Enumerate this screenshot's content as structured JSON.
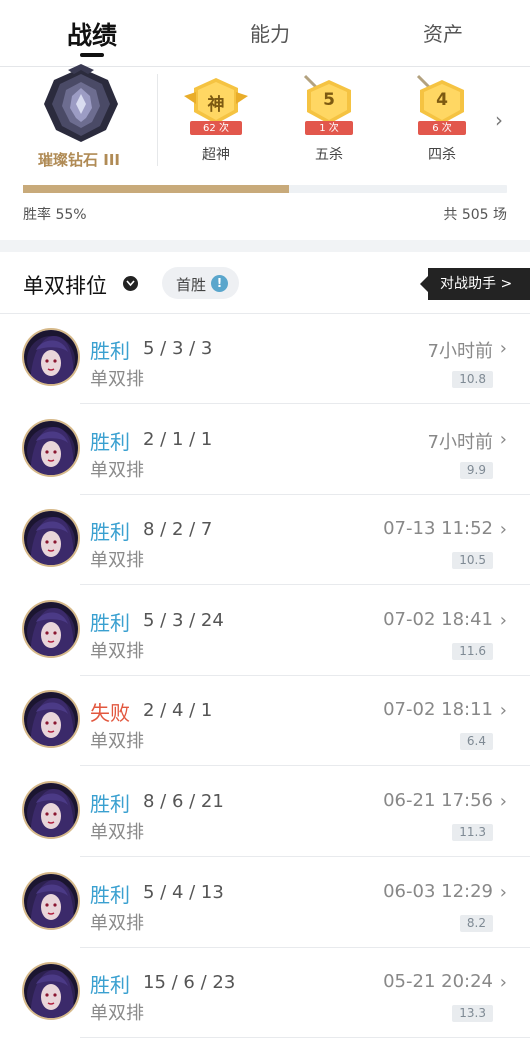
{
  "tabs": [
    "战绩",
    "能力",
    "资产"
  ],
  "rank": {
    "name": "璀璨钻石 III"
  },
  "medals": [
    {
      "glyph": "神",
      "count": "62 次",
      "label": "超神",
      "icon": "shield-medal-icon"
    },
    {
      "glyph": "5",
      "count": "1 次",
      "label": "五杀",
      "icon": "sword-medal-icon"
    },
    {
      "glyph": "4",
      "count": "6 次",
      "label": "四杀",
      "icon": "sword-medal-icon"
    }
  ],
  "stats": {
    "win_rate_text": "胜率 55%",
    "win_rate": 0.55,
    "total_text": "共 505 场"
  },
  "filter": {
    "mode": "单双排位",
    "first_win": "首胜",
    "first_win_badge": "!",
    "assistant": "对战助手 >"
  },
  "matches": [
    {
      "result": "胜利",
      "outcome": "win",
      "kda": "5 / 3 / 3",
      "queue": "单双排",
      "time": "7小时前",
      "score": "10.8"
    },
    {
      "result": "胜利",
      "outcome": "win",
      "kda": "2 / 1 / 1",
      "queue": "单双排",
      "time": "7小时前",
      "score": "9.9"
    },
    {
      "result": "胜利",
      "outcome": "win",
      "kda": "8 / 2 / 7",
      "queue": "单双排",
      "time": "07-13 11:52",
      "score": "10.5"
    },
    {
      "result": "胜利",
      "outcome": "win",
      "kda": "5 / 3 / 24",
      "queue": "单双排",
      "time": "07-02 18:41",
      "score": "11.6"
    },
    {
      "result": "失败",
      "outcome": "loss",
      "kda": "2 / 4 / 1",
      "queue": "单双排",
      "time": "07-02 18:11",
      "score": "6.4"
    },
    {
      "result": "胜利",
      "outcome": "win",
      "kda": "8 / 6 / 21",
      "queue": "单双排",
      "time": "06-21 17:56",
      "score": "11.3"
    },
    {
      "result": "胜利",
      "outcome": "win",
      "kda": "5 / 4 / 13",
      "queue": "单双排",
      "time": "06-03 12:29",
      "score": "8.2"
    },
    {
      "result": "胜利",
      "outcome": "win",
      "kda": "15 / 6 / 23",
      "queue": "单双排",
      "time": "05-21 20:24",
      "score": "13.3"
    }
  ],
  "colors": {
    "win": "#3aa0d0",
    "loss": "#e2573e",
    "accent_gold": "#c8aa7a"
  }
}
